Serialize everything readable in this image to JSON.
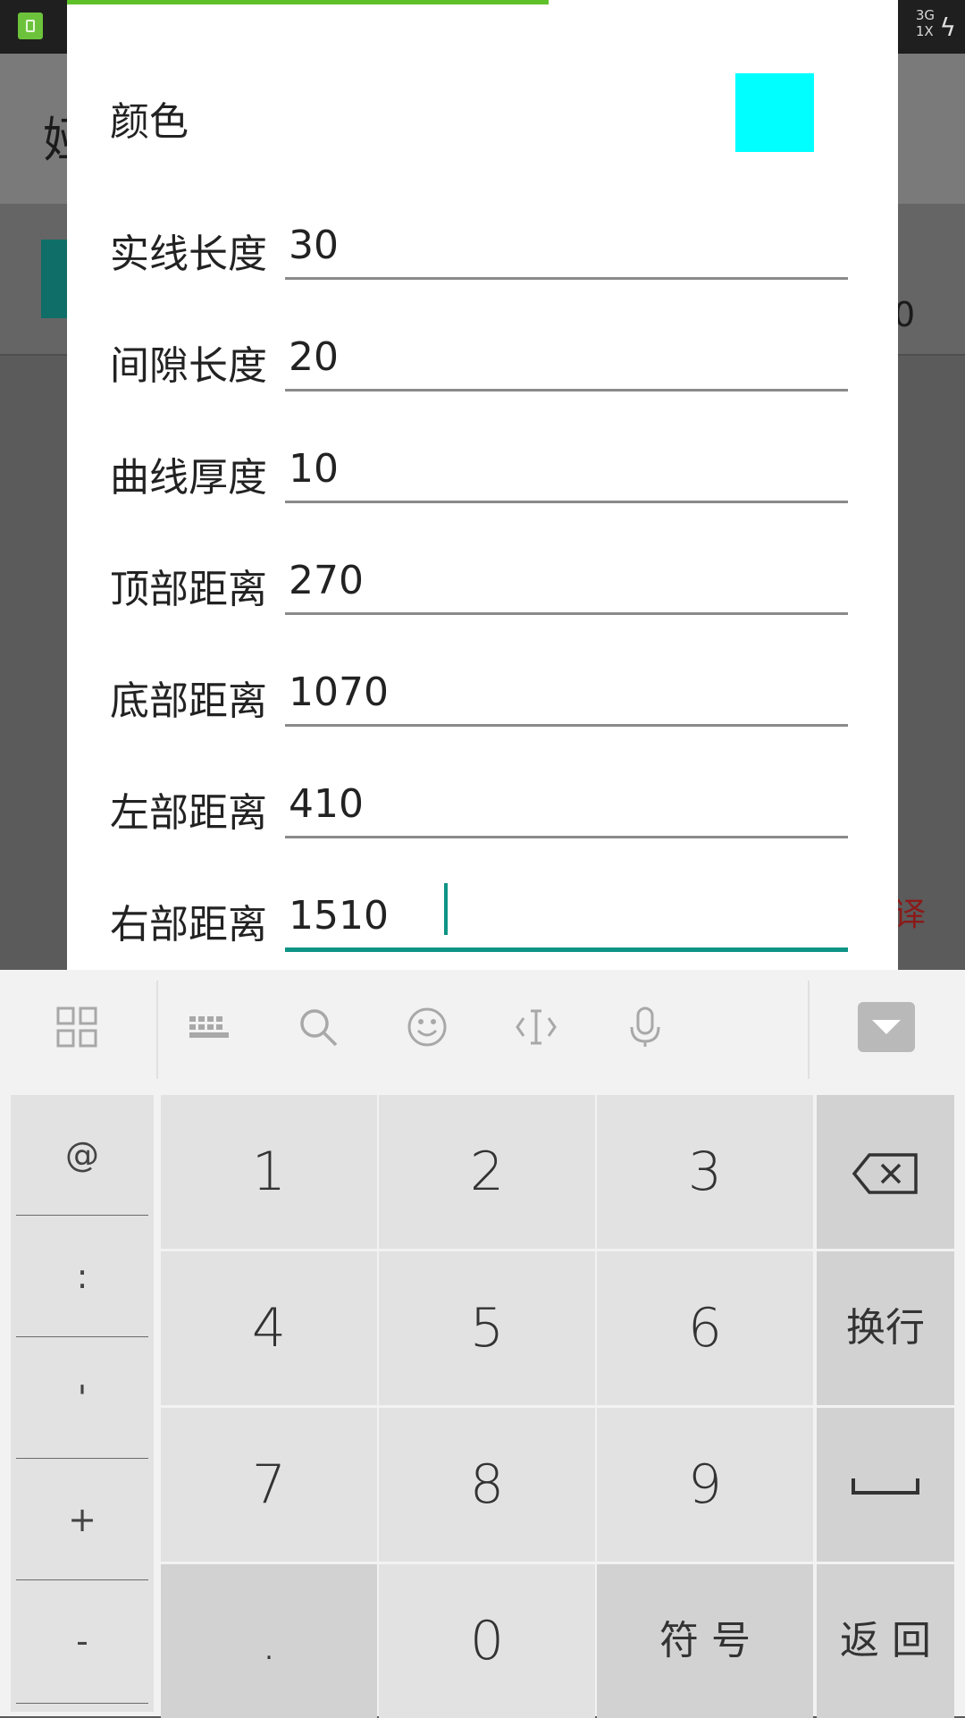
{
  "status_bar": {
    "network_top": "3G",
    "network_bottom": "1X"
  },
  "background": {
    "title_partial": "娅",
    "right_partial_number": "0",
    "red_partial_text": "译"
  },
  "dialog": {
    "progress_percent": 58,
    "color_label": "颜色",
    "color_value": "#00ffff",
    "fields": [
      {
        "label": "实线长度",
        "value": "30"
      },
      {
        "label": "间隙长度",
        "value": "20"
      },
      {
        "label": "曲线厚度",
        "value": "10"
      },
      {
        "label": "顶部距离",
        "value": "270"
      },
      {
        "label": "底部距离",
        "value": "1070"
      },
      {
        "label": "左部距离",
        "value": "410"
      },
      {
        "label": "右部距离",
        "value": "1510"
      }
    ],
    "focused_field_index": 6
  },
  "keyboard": {
    "toolbar_icons": [
      "grid-icon",
      "keyboard-icon",
      "search-icon",
      "emoji-icon",
      "cursor-icon",
      "microphone-icon",
      "collapse-icon"
    ],
    "symbols": [
      "@",
      ":",
      "'",
      "+",
      "-"
    ],
    "digits": [
      "1",
      "2",
      "3",
      "4",
      "5",
      "6",
      "7",
      "8",
      "9",
      "0"
    ],
    "dot": ".",
    "enter_label": "换行",
    "symbol_label": "符 号",
    "back_label": "返 回"
  }
}
